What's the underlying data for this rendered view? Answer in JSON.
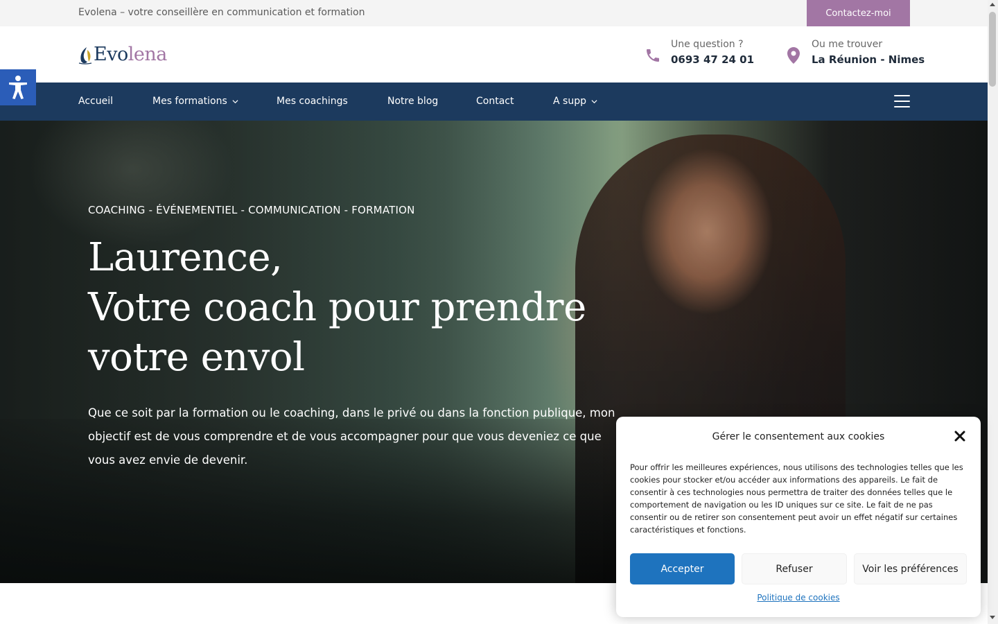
{
  "topbar": {
    "tagline": "Evolena – votre conseillère en communication et formation",
    "contact_button": "Contactez-moi"
  },
  "header": {
    "logo": {
      "part1": "Evo",
      "part2": "lena"
    },
    "phone": {
      "label": "Une question ?",
      "value": "0693 47 24 01",
      "icon": "phone-icon"
    },
    "location": {
      "label": "Ou me trouver",
      "value": "La Réunion - Nimes",
      "icon": "location-pin-icon"
    }
  },
  "nav": {
    "items": [
      {
        "label": "Accueil",
        "dropdown": false
      },
      {
        "label": "Mes formations",
        "dropdown": true
      },
      {
        "label": "Mes coachings",
        "dropdown": false
      },
      {
        "label": "Notre blog",
        "dropdown": false
      },
      {
        "label": "Contact",
        "dropdown": false
      },
      {
        "label": "A supp",
        "dropdown": true
      }
    ],
    "menu_icon": "hamburger-icon"
  },
  "accessibility_icon": "accessibility-icon",
  "hero": {
    "kicker": "COACHING - ÉVÉNEMENTIEL - COMMUNICATION - FORMATION",
    "title_lines": [
      "Laurence,",
      "Votre coach pour prendre",
      "votre envol"
    ],
    "description": "Que ce soit par la formation ou le coaching, dans le privé ou dans la fonction publique, mon objectif est de vous comprendre et de vous accompagner pour que vous deveniez ce que vous avez envie de devenir."
  },
  "cookie": {
    "title": "Gérer le consentement aux cookies",
    "body": "Pour offrir les meilleures expériences, nous utilisons des technologies telles que les cookies pour stocker et/ou accéder aux informations des appareils. Le fait de consentir à ces technologies nous permettra de traiter des données telles que le comportement de navigation ou les ID uniques sur ce site. Le fait de ne pas consentir ou de retirer son consentement peut avoir un effet négatif sur certaines caractéristiques et fonctions.",
    "accept": "Accepter",
    "refuse": "Refuser",
    "preferences": "Voir les préférences",
    "policy_link": "Politique de cookies"
  },
  "colors": {
    "navy": "#1c3a5e",
    "mauve": "#a276a4",
    "accept_blue": "#1e73be",
    "accessibility_blue": "#2b5db8"
  }
}
